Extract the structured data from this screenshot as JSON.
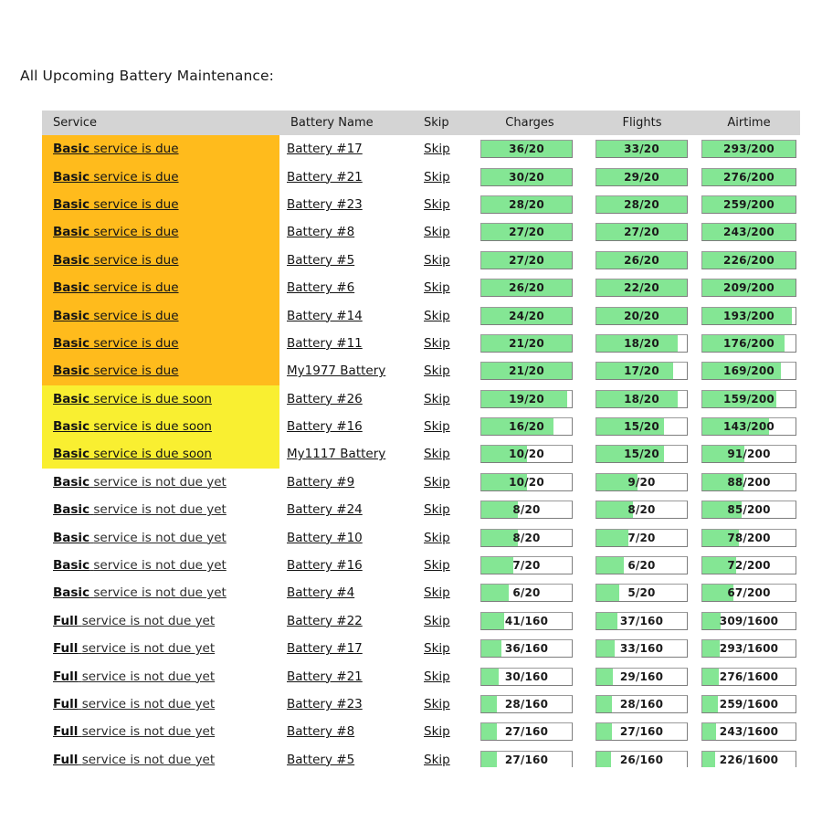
{
  "page": {
    "title": "All Upcoming Battery Maintenance:"
  },
  "table": {
    "columns": [
      {
        "key": "service",
        "label": "Service"
      },
      {
        "key": "battery",
        "label": "Battery Name"
      },
      {
        "key": "skip",
        "label": "Skip"
      },
      {
        "key": "charges",
        "label": "Charges"
      },
      {
        "key": "flights",
        "label": "Flights"
      },
      {
        "key": "airtime",
        "label": "Airtime"
      }
    ],
    "skip_label": "Skip",
    "colors": {
      "header_bg": "#d4d4d4",
      "due": "#ffbb1c",
      "due_soon": "#f9ef31",
      "not_due": "#ffffff",
      "meter_fill": "#84e694",
      "meter_border": "#8a8a8a"
    },
    "states": {
      "due": "service is due",
      "due_soon": "service is due soon",
      "not_due": "service is not due yet"
    },
    "rows": [
      {
        "service_type": "Basic",
        "service_text": "service is due",
        "state": "due",
        "battery": "Battery #17",
        "charges": {
          "value": 36,
          "max": 20,
          "label": "36/20"
        },
        "flights": {
          "value": 33,
          "max": 20,
          "label": "33/20"
        },
        "airtime": {
          "value": 293,
          "max": 200,
          "label": "293/200"
        }
      },
      {
        "service_type": "Basic",
        "service_text": "service is due",
        "state": "due",
        "battery": "Battery #21",
        "charges": {
          "value": 30,
          "max": 20,
          "label": "30/20"
        },
        "flights": {
          "value": 29,
          "max": 20,
          "label": "29/20"
        },
        "airtime": {
          "value": 276,
          "max": 200,
          "label": "276/200"
        }
      },
      {
        "service_type": "Basic",
        "service_text": "service is due",
        "state": "due",
        "battery": "Battery #23",
        "charges": {
          "value": 28,
          "max": 20,
          "label": "28/20"
        },
        "flights": {
          "value": 28,
          "max": 20,
          "label": "28/20"
        },
        "airtime": {
          "value": 259,
          "max": 200,
          "label": "259/200"
        }
      },
      {
        "service_type": "Basic",
        "service_text": "service is due",
        "state": "due",
        "battery": "Battery #8",
        "charges": {
          "value": 27,
          "max": 20,
          "label": "27/20"
        },
        "flights": {
          "value": 27,
          "max": 20,
          "label": "27/20"
        },
        "airtime": {
          "value": 243,
          "max": 200,
          "label": "243/200"
        }
      },
      {
        "service_type": "Basic",
        "service_text": "service is due",
        "state": "due",
        "battery": "Battery #5",
        "charges": {
          "value": 27,
          "max": 20,
          "label": "27/20"
        },
        "flights": {
          "value": 26,
          "max": 20,
          "label": "26/20"
        },
        "airtime": {
          "value": 226,
          "max": 200,
          "label": "226/200"
        }
      },
      {
        "service_type": "Basic",
        "service_text": "service is due",
        "state": "due",
        "battery": "Battery #6",
        "charges": {
          "value": 26,
          "max": 20,
          "label": "26/20"
        },
        "flights": {
          "value": 22,
          "max": 20,
          "label": "22/20"
        },
        "airtime": {
          "value": 209,
          "max": 200,
          "label": "209/200"
        }
      },
      {
        "service_type": "Basic",
        "service_text": "service is due",
        "state": "due",
        "battery": "Battery #14",
        "charges": {
          "value": 24,
          "max": 20,
          "label": "24/20"
        },
        "flights": {
          "value": 20,
          "max": 20,
          "label": "20/20"
        },
        "airtime": {
          "value": 193,
          "max": 200,
          "label": "193/200"
        }
      },
      {
        "service_type": "Basic",
        "service_text": "service is due",
        "state": "due",
        "battery": "Battery #11",
        "charges": {
          "value": 21,
          "max": 20,
          "label": "21/20"
        },
        "flights": {
          "value": 18,
          "max": 20,
          "label": "18/20"
        },
        "airtime": {
          "value": 176,
          "max": 200,
          "label": "176/200"
        }
      },
      {
        "service_type": "Basic",
        "service_text": "service is due",
        "state": "due",
        "battery": "My1977 Battery",
        "charges": {
          "value": 21,
          "max": 20,
          "label": "21/20"
        },
        "flights": {
          "value": 17,
          "max": 20,
          "label": "17/20"
        },
        "airtime": {
          "value": 169,
          "max": 200,
          "label": "169/200"
        }
      },
      {
        "service_type": "Basic",
        "service_text": "service is due soon",
        "state": "due_soon",
        "battery": "Battery #26",
        "charges": {
          "value": 19,
          "max": 20,
          "label": "19/20"
        },
        "flights": {
          "value": 18,
          "max": 20,
          "label": "18/20"
        },
        "airtime": {
          "value": 159,
          "max": 200,
          "label": "159/200"
        }
      },
      {
        "service_type": "Basic",
        "service_text": "service is due soon",
        "state": "due_soon",
        "battery": "Battery #16",
        "charges": {
          "value": 16,
          "max": 20,
          "label": "16/20"
        },
        "flights": {
          "value": 15,
          "max": 20,
          "label": "15/20"
        },
        "airtime": {
          "value": 143,
          "max": 200,
          "label": "143/200"
        }
      },
      {
        "service_type": "Basic",
        "service_text": "service is due soon",
        "state": "due_soon",
        "battery": "My1117 Battery",
        "charges": {
          "value": 10,
          "max": 20,
          "label": "10/20"
        },
        "flights": {
          "value": 15,
          "max": 20,
          "label": "15/20"
        },
        "airtime": {
          "value": 91,
          "max": 200,
          "label": "91/200"
        }
      },
      {
        "service_type": "Basic",
        "service_text": "service is not due yet",
        "state": "not_due",
        "battery": "Battery #9",
        "charges": {
          "value": 10,
          "max": 20,
          "label": "10/20"
        },
        "flights": {
          "value": 9,
          "max": 20,
          "label": "9/20"
        },
        "airtime": {
          "value": 88,
          "max": 200,
          "label": "88/200"
        }
      },
      {
        "service_type": "Basic",
        "service_text": "service is not due yet",
        "state": "not_due",
        "battery": "Battery #24",
        "charges": {
          "value": 8,
          "max": 20,
          "label": "8/20"
        },
        "flights": {
          "value": 8,
          "max": 20,
          "label": "8/20"
        },
        "airtime": {
          "value": 85,
          "max": 200,
          "label": "85/200"
        }
      },
      {
        "service_type": "Basic",
        "service_text": "service is not due yet",
        "state": "not_due",
        "battery": "Battery #10",
        "charges": {
          "value": 8,
          "max": 20,
          "label": "8/20"
        },
        "flights": {
          "value": 7,
          "max": 20,
          "label": "7/20"
        },
        "airtime": {
          "value": 78,
          "max": 200,
          "label": "78/200"
        }
      },
      {
        "service_type": "Basic",
        "service_text": "service is not due yet",
        "state": "not_due",
        "battery": "Battery #16",
        "charges": {
          "value": 7,
          "max": 20,
          "label": "7/20"
        },
        "flights": {
          "value": 6,
          "max": 20,
          "label": "6/20"
        },
        "airtime": {
          "value": 72,
          "max": 200,
          "label": "72/200"
        }
      },
      {
        "service_type": "Basic",
        "service_text": "service is not due yet",
        "state": "not_due",
        "battery": "Battery #4",
        "charges": {
          "value": 6,
          "max": 20,
          "label": "6/20"
        },
        "flights": {
          "value": 5,
          "max": 20,
          "label": "5/20"
        },
        "airtime": {
          "value": 67,
          "max": 200,
          "label": "67/200"
        }
      },
      {
        "service_type": "Full",
        "service_text": "service is not due yet",
        "state": "not_due",
        "battery": "Battery #22",
        "charges": {
          "value": 41,
          "max": 160,
          "label": "41/160"
        },
        "flights": {
          "value": 37,
          "max": 160,
          "label": "37/160"
        },
        "airtime": {
          "value": 309,
          "max": 1600,
          "label": "309/1600"
        }
      },
      {
        "service_type": "Full",
        "service_text": "service is not due yet",
        "state": "not_due",
        "battery": "Battery #17",
        "charges": {
          "value": 36,
          "max": 160,
          "label": "36/160"
        },
        "flights": {
          "value": 33,
          "max": 160,
          "label": "33/160"
        },
        "airtime": {
          "value": 293,
          "max": 1600,
          "label": "293/1600"
        }
      },
      {
        "service_type": "Full",
        "service_text": "service is not due yet",
        "state": "not_due",
        "battery": "Battery #21",
        "charges": {
          "value": 30,
          "max": 160,
          "label": "30/160"
        },
        "flights": {
          "value": 29,
          "max": 160,
          "label": "29/160"
        },
        "airtime": {
          "value": 276,
          "max": 1600,
          "label": "276/1600"
        }
      },
      {
        "service_type": "Full",
        "service_text": "service is not due yet",
        "state": "not_due",
        "battery": "Battery #23",
        "charges": {
          "value": 28,
          "max": 160,
          "label": "28/160"
        },
        "flights": {
          "value": 28,
          "max": 160,
          "label": "28/160"
        },
        "airtime": {
          "value": 259,
          "max": 1600,
          "label": "259/1600"
        }
      },
      {
        "service_type": "Full",
        "service_text": "service is not due yet",
        "state": "not_due",
        "battery": "Battery #8",
        "charges": {
          "value": 27,
          "max": 160,
          "label": "27/160"
        },
        "flights": {
          "value": 27,
          "max": 160,
          "label": "27/160"
        },
        "airtime": {
          "value": 243,
          "max": 1600,
          "label": "243/1600"
        }
      },
      {
        "service_type": "Full",
        "service_text": "service is not due yet",
        "state": "not_due",
        "battery": "Battery #5",
        "charges": {
          "value": 27,
          "max": 160,
          "label": "27/160"
        },
        "flights": {
          "value": 26,
          "max": 160,
          "label": "26/160"
        },
        "airtime": {
          "value": 226,
          "max": 1600,
          "label": "226/1600"
        }
      }
    ]
  }
}
